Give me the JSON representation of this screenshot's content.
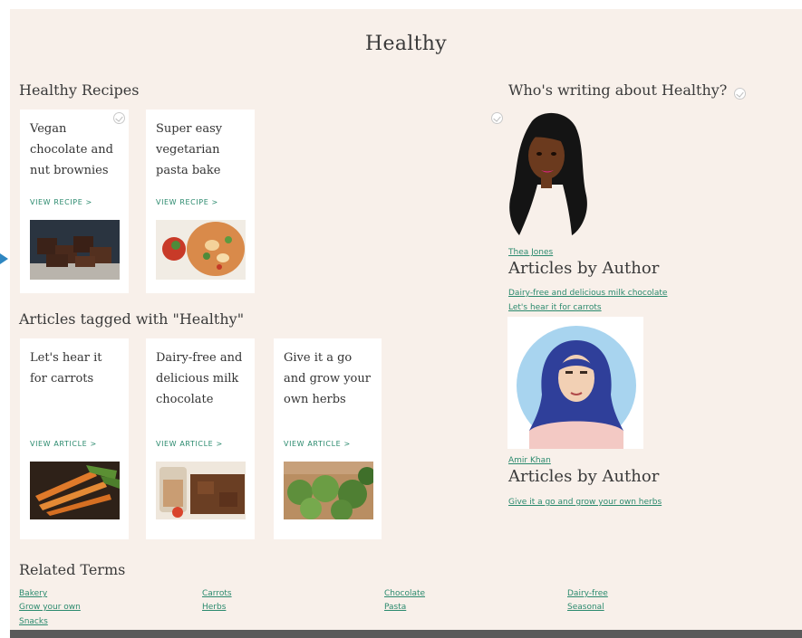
{
  "page": {
    "title": "Healthy"
  },
  "recipes": {
    "heading": "Healthy Recipes",
    "items": [
      {
        "title": "Vegan chocolate and nut brownies",
        "link": "VIEW RECIPE >",
        "image": "brownies-photo"
      },
      {
        "title": "Super easy vegetarian pasta bake",
        "link": "VIEW RECIPE >",
        "image": "pasta-bake-photo"
      }
    ]
  },
  "articles": {
    "heading": "Articles tagged with \"Healthy\"",
    "items": [
      {
        "title": "Let's hear it for carrots",
        "link": "VIEW ARTICLE >",
        "image": "carrots-photo"
      },
      {
        "title": "Dairy-free and delicious milk chocolate",
        "link": "VIEW ARTICLE >",
        "image": "chocolate-photo"
      },
      {
        "title": "Give it a go and grow your own herbs",
        "link": "VIEW ARTICLE >",
        "image": "herbs-photo"
      }
    ]
  },
  "authors": {
    "heading": "Who's writing about Healthy?",
    "list": [
      {
        "name": "Thea Jones",
        "articles_heading": "Articles by Author",
        "articles": [
          "Dairy-free and delicious milk chocolate",
          "Let's hear it for carrots"
        ]
      },
      {
        "name": "Amir Khan",
        "articles_heading": "Articles by Author",
        "articles": [
          "Give it a go and grow your own herbs"
        ]
      }
    ]
  },
  "related": {
    "heading": "Related Terms",
    "terms": [
      "Bakery",
      "Carrots",
      "Chocolate",
      "Dairy-free",
      "Grow your own",
      "Herbs",
      "Pasta",
      "Seasonal",
      "Snacks"
    ]
  },
  "colors": {
    "page_bg": "#f8f0ea",
    "link": "#2b8a6e",
    "text": "#3a3a3a",
    "card": "#ffffff",
    "footer": "#5a5a5a"
  }
}
